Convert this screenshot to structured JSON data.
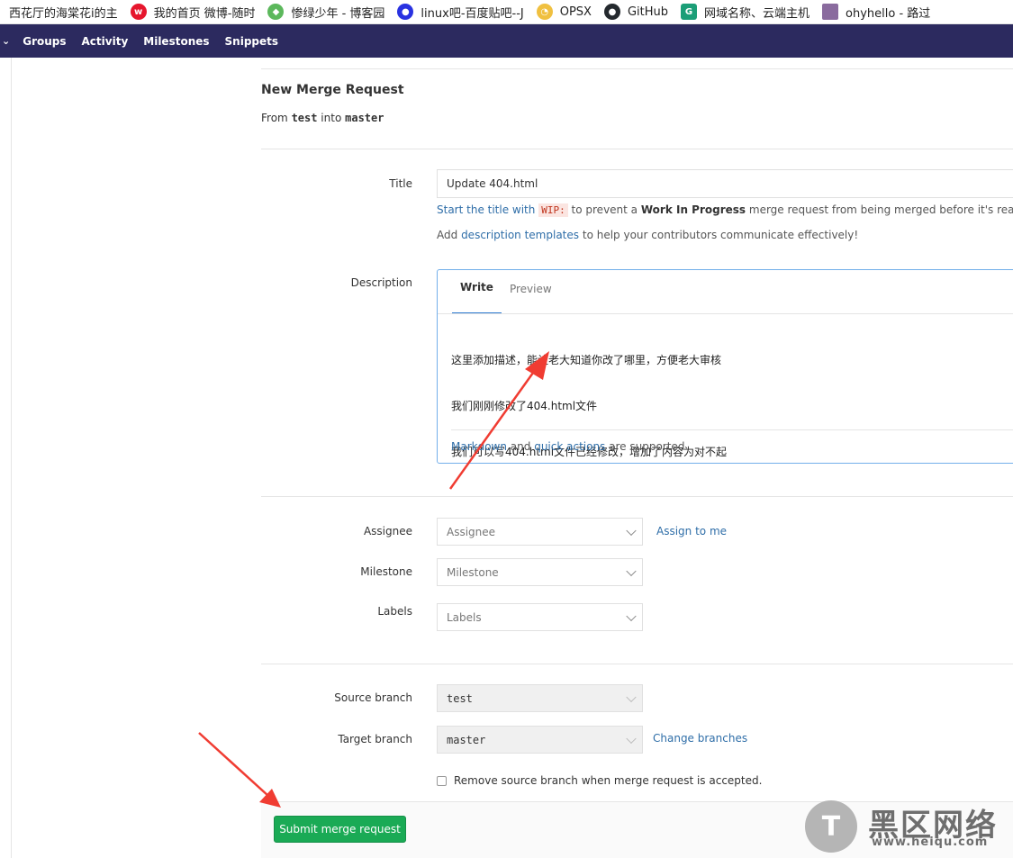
{
  "bookmarks": [
    {
      "label": "西花厅的海棠花i的主",
      "icon": "blank-icon",
      "color": "#ffffff"
    },
    {
      "label": "我的首页 微博-随时",
      "icon": "weibo-icon",
      "color": "#e6162d"
    },
    {
      "label": "惨绿少年 - 博客园",
      "icon": "frog-icon",
      "color": "#5cb85c"
    },
    {
      "label": "linux吧-百度贴吧--J",
      "icon": "baidu-paw-icon",
      "color": "#2932e1"
    },
    {
      "label": "OPSX",
      "icon": "opsx-icon",
      "color": "#f0c040"
    },
    {
      "label": "GitHub",
      "icon": "github-icon",
      "color": "#24292e"
    },
    {
      "label": "网域名称、云端主机",
      "icon": "domain-icon",
      "color": "#1b9e77"
    },
    {
      "label": "ohyhello - 路过",
      "icon": "avatar-icon",
      "color": "#8a6b9e"
    }
  ],
  "navbar": {
    "items": [
      "Groups",
      "Activity",
      "Milestones",
      "Snippets"
    ],
    "background": "#2c2a5f"
  },
  "form": {
    "heading": "New Merge Request",
    "from_prefix": "From",
    "source_branch": "test",
    "into_word": "into",
    "target_branch": "master",
    "title_label": "Title",
    "title_value": "Update 404.html",
    "wip_hint": {
      "link": "Start the title with",
      "code": "WIP:",
      "middle": "to prevent a",
      "bold": "Work In Progress",
      "end": "merge request from being merged before it's ready."
    },
    "template_hint": {
      "prefix": "Add",
      "link": "description templates",
      "suffix": "to help your contributors communicate effectively!"
    },
    "description_label": "Description",
    "tab_write": "Write",
    "tab_preview": "Preview",
    "description_lines": [
      "这里添加描述，能让老大知道你改了哪里，方便老大审核",
      "我们刚刚修改了404.html文件",
      "我们可以写404.html文件已经修改，增加了内容为对不起"
    ],
    "markdown_link": "Markdown",
    "and_word": "and",
    "quick_actions_link": "quick actions",
    "supported_suffix": "are supported",
    "assignee_label": "Assignee",
    "assignee_placeholder": "Assignee",
    "assign_to_me": "Assign to me",
    "milestone_label": "Milestone",
    "milestone_placeholder": "Milestone",
    "labels_label": "Labels",
    "labels_placeholder": "Labels",
    "source_branch_label": "Source branch",
    "source_branch_value": "test",
    "target_branch_label": "Target branch",
    "target_branch_value": "master",
    "change_branches": "Change branches",
    "remove_source_label": "Remove source branch when merge request is accepted.",
    "submit_label": "Submit merge request"
  },
  "watermark": {
    "name": "黑区网络",
    "url": "www.heiqu.com"
  },
  "colors": {
    "link": "#2f6ea8",
    "submit": "#1aaa55",
    "annotation_arrow": "#f03c32"
  }
}
